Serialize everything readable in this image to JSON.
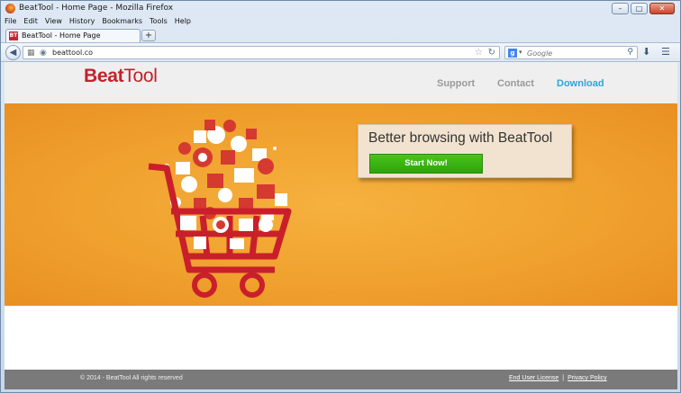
{
  "window": {
    "title": "BeatTool - Home Page - Mozilla Firefox",
    "buttons": {
      "minimize": "–",
      "maximize": "□",
      "close": "✕"
    }
  },
  "menubar": {
    "items": [
      "File",
      "Edit",
      "View",
      "History",
      "Bookmarks",
      "Tools",
      "Help"
    ]
  },
  "tabs": [
    {
      "label": "BeatTool - Home Page",
      "favicon": "BT"
    }
  ],
  "newtab_label": "+",
  "navbar": {
    "url": "beattool.co",
    "search_placeholder": "Google",
    "search_engine_icon": "g"
  },
  "site": {
    "logo_beat": "Beat",
    "logo_tool": "Tool",
    "nav": {
      "support": "Support",
      "contact": "Contact",
      "download": "Download"
    },
    "hero": {
      "headline": "Better browsing with BeatTool",
      "cta_label": "Start Now!"
    },
    "footer": {
      "copyright": "© 2014 - BeatTool All rights reserved",
      "eula": "End User License",
      "separator": "|",
      "privacy": "Privacy Policy"
    }
  },
  "colors": {
    "brand_red": "#c4212b",
    "download_blue": "#2aa7d8",
    "hero_orange": "#f0a12e",
    "cta_green": "#3bb515"
  }
}
